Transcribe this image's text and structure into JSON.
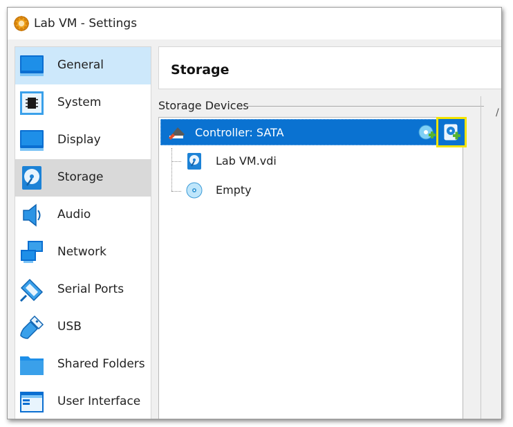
{
  "window": {
    "title": "Lab VM - Settings",
    "icon": "virtualbox-gear-icon"
  },
  "sidebar": {
    "items": [
      {
        "label": "General",
        "icon": "monitor-icon",
        "state": "selected"
      },
      {
        "label": "System",
        "icon": "chip-icon",
        "state": "normal"
      },
      {
        "label": "Display",
        "icon": "display-icon",
        "state": "normal"
      },
      {
        "label": "Storage",
        "icon": "storage-disk-icon",
        "state": "hover"
      },
      {
        "label": "Audio",
        "icon": "speaker-icon",
        "state": "normal"
      },
      {
        "label": "Network",
        "icon": "network-icon",
        "state": "normal"
      },
      {
        "label": "Serial Ports",
        "icon": "serial-plug-icon",
        "state": "normal"
      },
      {
        "label": "USB",
        "icon": "usb-icon",
        "state": "normal"
      },
      {
        "label": "Shared Folders",
        "icon": "folder-icon",
        "state": "normal"
      },
      {
        "label": "User Interface",
        "icon": "window-layout-icon",
        "state": "normal"
      }
    ]
  },
  "main": {
    "page_title": "Storage",
    "storage_devices_label": "Storage Devices",
    "controller": {
      "label": "Controller: SATA",
      "icon": "sata-controller-icon",
      "actions": [
        {
          "name": "add-optical-drive",
          "icon": "add-optical-drive-icon"
        },
        {
          "name": "add-hard-disk",
          "icon": "add-hard-disk-icon",
          "highlighted": true
        }
      ]
    },
    "attachments": [
      {
        "label": "Lab VM.vdi",
        "icon": "hard-disk-icon"
      },
      {
        "label": "Empty",
        "icon": "optical-disc-icon"
      }
    ]
  },
  "colors": {
    "selection_blue": "#0a72d1",
    "highlight_yellow": "#f3e400",
    "sidebar_selected": "#cde8fb",
    "sidebar_hover": "#d9d9d9",
    "plus_green": "#58b431"
  }
}
